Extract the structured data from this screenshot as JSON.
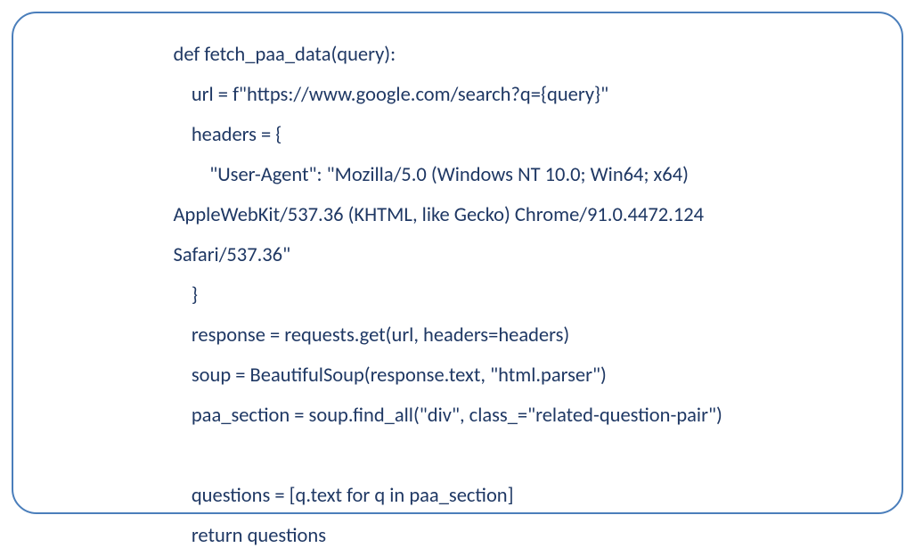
{
  "code": {
    "line1": "def fetch_paa_data(query):",
    "line2": "    url = f\"https://www.google.com/search?q={query}\"",
    "line3": "    headers = {",
    "line4": "        \"User-Agent\": \"Mozilla/5.0 (Windows NT 10.0; Win64; x64)",
    "line5": "AppleWebKit/537.36 (KHTML, like Gecko) Chrome/91.0.4472.124",
    "line6": "Safari/537.36\"",
    "line7": "    }",
    "line8": "    response = requests.get(url, headers=headers)",
    "line9": "    soup = BeautifulSoup(response.text, \"html.parser\")",
    "line10": "    paa_section = soup.find_all(\"div\", class_=\"related-question-pair\")",
    "line11": "",
    "line12": "    questions = [q.text for q in paa_section]",
    "line13": "    return questions"
  }
}
